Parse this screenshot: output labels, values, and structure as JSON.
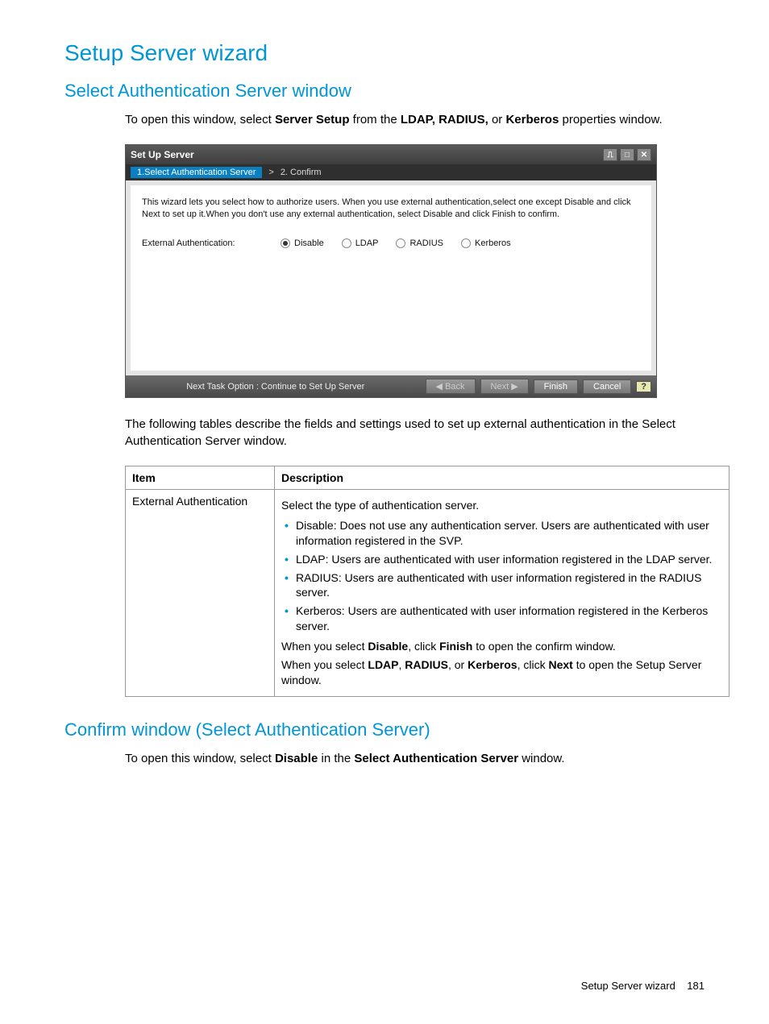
{
  "page": {
    "title": "Setup Server wizard",
    "section_title": "Select Authentication Server window",
    "intro_prefix": "To open this window, select ",
    "intro_bold1": "Server Setup",
    "intro_mid": " from the ",
    "intro_bold2": "LDAP, RADIUS,",
    "intro_or": " or ",
    "intro_bold3": "Kerberos",
    "intro_suffix": " properties window.",
    "post_text": "The following tables describe the fields and settings used to set up external authentication in the Select Authentication Server window.",
    "section2_title": "Confirm window (Select Authentication Server)",
    "section2_prefix": "To open this window, select ",
    "section2_bold1": "Disable",
    "section2_mid": " in the ",
    "section2_bold2": "Select Authentication Server",
    "section2_suffix": " window.",
    "footer_label": "Setup Server wizard",
    "footer_page": "181"
  },
  "wizard": {
    "title": "Set Up Server",
    "step1": "1.Select Authentication Server",
    "step_sep": ">",
    "step2": "2. Confirm",
    "message": "This wizard lets you select how to authorize users. When you use external authentication,select one except Disable and click Next to set up it.When you don't use any external authentication, select Disable and click Finish to confirm.",
    "radio_label": "External Authentication:",
    "options": [
      "Disable",
      "LDAP",
      "RADIUS",
      "Kerberos"
    ],
    "footer_text": "Next Task Option : Continue to Set Up Server",
    "back": "Back",
    "next": "Next",
    "finish": "Finish",
    "cancel": "Cancel",
    "help": "?"
  },
  "table": {
    "head_item": "Item",
    "head_desc": "Description",
    "row_item": "External Authentication",
    "row_intro": "Select the type of authentication server.",
    "bullets": [
      "Disable: Does not use any authentication server. Users are authenticated with user information registered in the SVP.",
      "LDAP: Users are authenticated with user information registered in the LDAP server.",
      "RADIUS: Users are authenticated with user information registered in the RADIUS server.",
      "Kerberos: Users are authenticated with user information registered in the Kerberos server."
    ],
    "post1_a": "When you select ",
    "post1_b1": "Disable",
    "post1_c": ", click ",
    "post1_b2": "Finish",
    "post1_d": " to open the confirm window.",
    "post2_a": "When you select ",
    "post2_b1": "LDAP",
    "post2_c": ", ",
    "post2_b2": "RADIUS",
    "post2_d": ", or ",
    "post2_b3": "Kerberos",
    "post2_e": ", click ",
    "post2_b4": "Next",
    "post2_f": " to open the Setup Server window."
  }
}
